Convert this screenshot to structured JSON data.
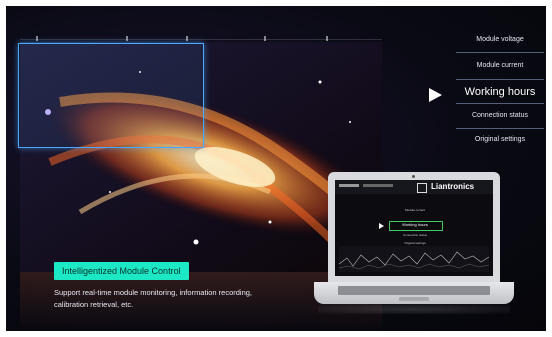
{
  "menu": {
    "items": [
      {
        "label": "Module voltage",
        "active": false
      },
      {
        "label": "Module current",
        "active": false
      },
      {
        "label": "Working hours",
        "active": true
      },
      {
        "label": "Connection status",
        "active": false
      },
      {
        "label": "Original settings",
        "active": false
      }
    ]
  },
  "feature": {
    "badge": "Intelligentized Module Control",
    "description": "Support real-time module monitoring, information recording, calibration retrieval, etc."
  },
  "laptop_screen": {
    "brand": "Liantronics",
    "menu": [
      "Module current",
      "Working hours",
      "Connection status",
      "Original settings"
    ]
  },
  "colors": {
    "accent": "#1de8c6",
    "selection": "#4aa8ff"
  }
}
